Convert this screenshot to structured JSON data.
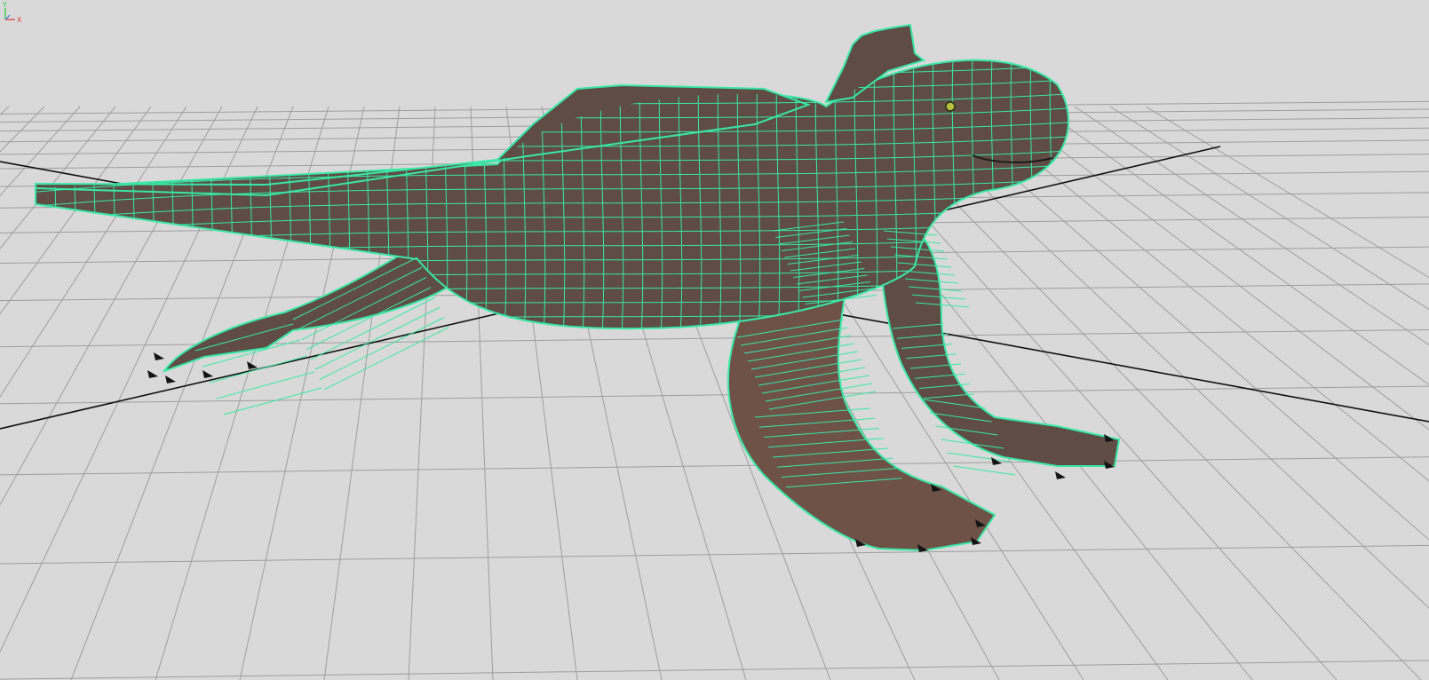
{
  "viewport": {
    "background_color": "#d9d9d9",
    "grid_color": "#9e9e9e",
    "origin_axis_color": "#101010",
    "wireframe_color": "#39e8a6",
    "model_skin_color": "#5e4c45",
    "claw_color": "#141414"
  },
  "model": {
    "name": "iguana-mesh",
    "selected": true
  },
  "axis_indicator": {
    "y_label": "Y",
    "x_label": "X",
    "z_label": "Z",
    "y_color": "#2ecc40",
    "x_color": "#e04040",
    "z_color": "#3a6fe0"
  }
}
